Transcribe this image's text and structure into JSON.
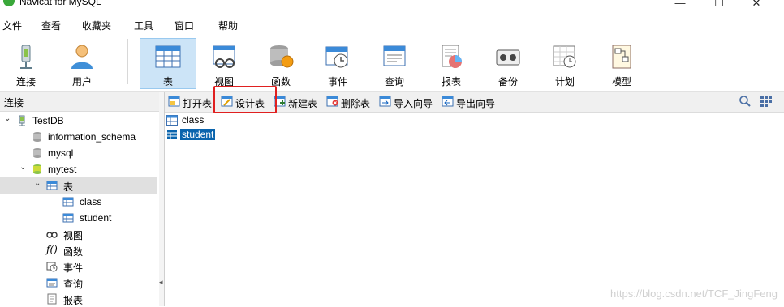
{
  "window": {
    "title": "Navicat for MySQL",
    "min": "—",
    "max": "☐",
    "close": "✕"
  },
  "menu": [
    "文件",
    "查看",
    "收藏夹",
    "工具",
    "窗口",
    "帮助"
  ],
  "toolbar": [
    {
      "label": "连接",
      "icon": "connection-icon"
    },
    {
      "label": "用户",
      "icon": "user-icon"
    },
    {
      "label": "表",
      "icon": "table-icon",
      "active": true
    },
    {
      "label": "视图",
      "icon": "view-icon"
    },
    {
      "label": "函数",
      "icon": "function-icon"
    },
    {
      "label": "事件",
      "icon": "event-icon"
    },
    {
      "label": "查询",
      "icon": "query-icon"
    },
    {
      "label": "报表",
      "icon": "report-icon"
    },
    {
      "label": "备份",
      "icon": "backup-icon"
    },
    {
      "label": "计划",
      "icon": "schedule-icon"
    },
    {
      "label": "模型",
      "icon": "model-icon"
    }
  ],
  "left": {
    "header": "连接",
    "tree": [
      {
        "label": "TestDB",
        "expanded": true,
        "icon": "connection-icon"
      },
      {
        "label": "information_schema",
        "icon": "database-icon"
      },
      {
        "label": "mysql",
        "icon": "database-icon"
      },
      {
        "label": "mytest",
        "expanded": true,
        "icon": "database-open-icon"
      },
      {
        "label": "表",
        "expanded": true,
        "icon": "table-folder-icon",
        "selected": true
      },
      {
        "label": "class",
        "icon": "table-icon"
      },
      {
        "label": "student",
        "icon": "table-icon"
      },
      {
        "label": "视图",
        "icon": "view-icon"
      },
      {
        "label": "函数",
        "icon": "function-icon"
      },
      {
        "label": "事件",
        "icon": "event-icon"
      },
      {
        "label": "查询",
        "icon": "query-icon"
      },
      {
        "label": "报表",
        "icon": "report-icon"
      }
    ]
  },
  "objbar": {
    "open": "打开表",
    "design": "设计表",
    "new": "新建表",
    "delete": "删除表",
    "import": "导入向导",
    "export": "导出向导"
  },
  "content": {
    "items": [
      {
        "label": "class",
        "selected": false
      },
      {
        "label": "student",
        "selected": true
      }
    ]
  },
  "watermark": "https://blog.csdn.net/TCF_JingFeng",
  "colors": {
    "accent": "#0a64ad",
    "highlight": "#e02020",
    "active_tab": "#cce4f7"
  }
}
